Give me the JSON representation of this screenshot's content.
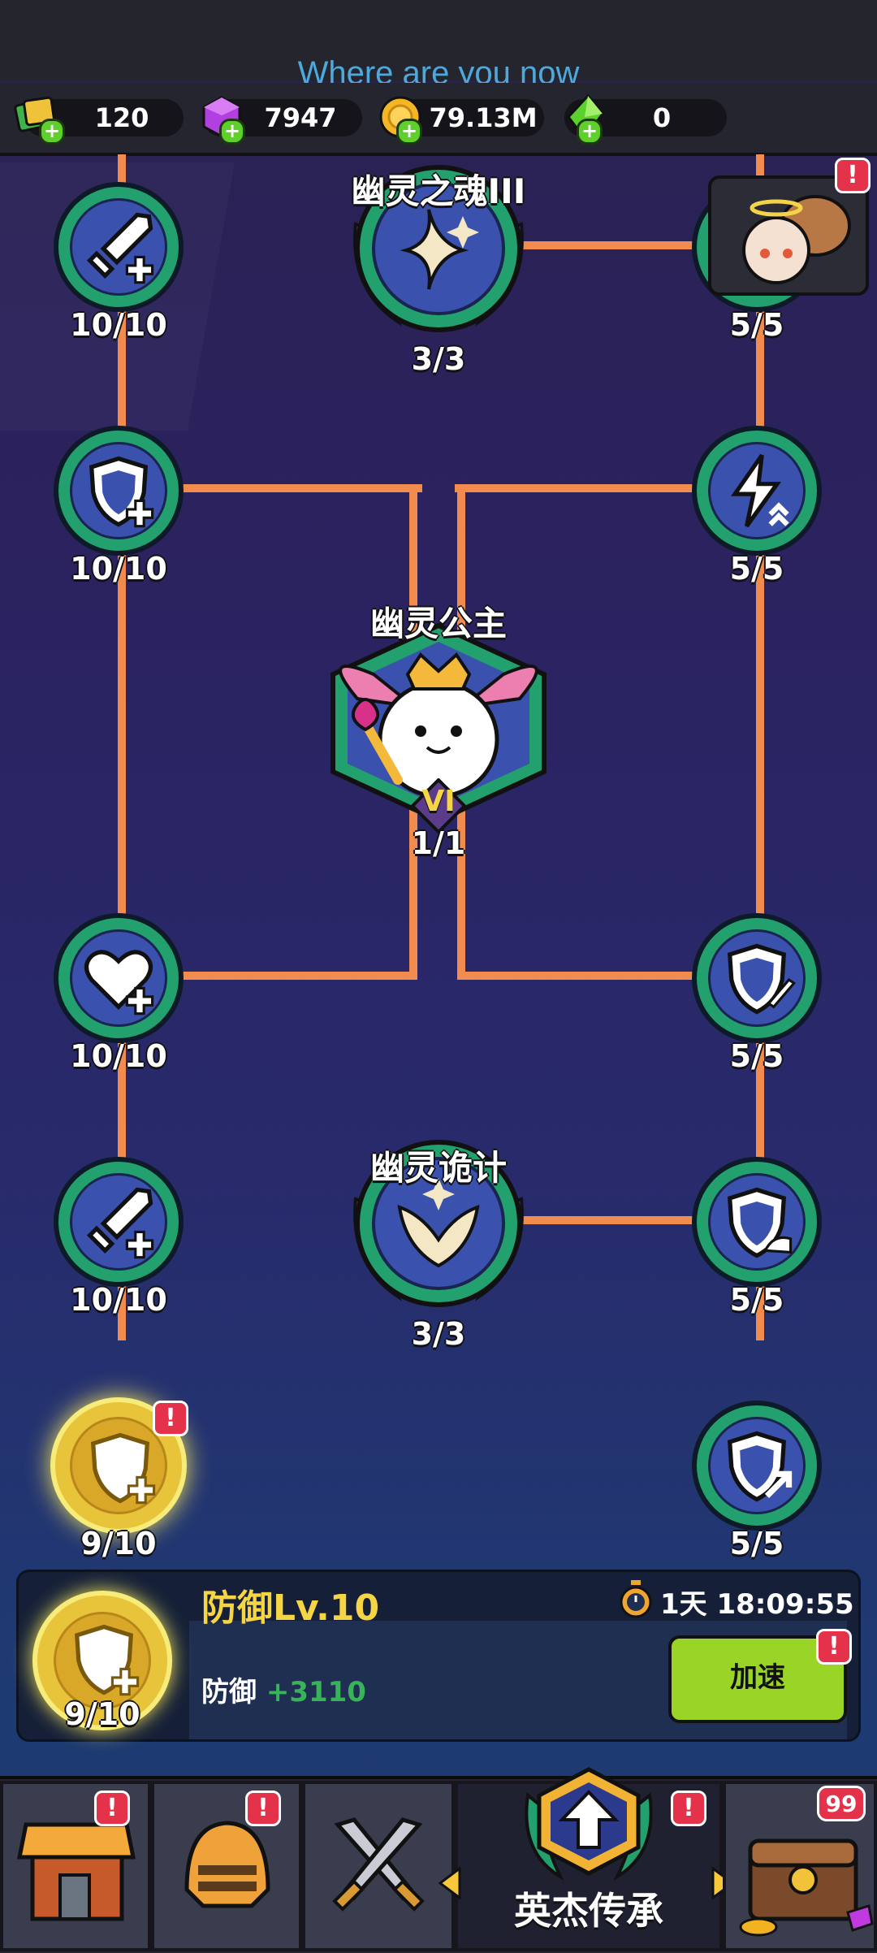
{
  "top_hint": "Where are you now",
  "resources": [
    {
      "icon": "ticket-icon",
      "value": "120"
    },
    {
      "icon": "purple-gem-icon",
      "value": "7947"
    },
    {
      "icon": "gold-coin-icon",
      "value": "79.13M"
    },
    {
      "icon": "green-crystal-icon",
      "value": "0"
    }
  ],
  "tree": {
    "top_title": "幽灵之魂III",
    "top_count": "3/3",
    "center_title": "幽灵公主",
    "center_rank": "VI",
    "center_count": "1/1",
    "lower_title": "幽灵诡计",
    "lower_count": "3/3",
    "left_nodes": [
      {
        "icon": "sword-plus-icon",
        "count": "10/10"
      },
      {
        "icon": "shield-plus-icon",
        "count": "10/10"
      },
      {
        "icon": "heart-plus-icon",
        "count": "10/10"
      },
      {
        "icon": "sword-plus-icon",
        "count": "10/10"
      },
      {
        "icon": "shield-plus-icon",
        "count": "9/10"
      }
    ],
    "right_nodes": [
      {
        "icon": "portrait-icon",
        "count": "5/5"
      },
      {
        "icon": "lightning-up-icon",
        "count": "5/5"
      },
      {
        "icon": "shield-sword-icon",
        "count": "5/5"
      },
      {
        "icon": "shield-hand-icon",
        "count": "5/5"
      },
      {
        "icon": "shield-arrow-icon",
        "count": "5/5"
      }
    ]
  },
  "detail": {
    "title": "防御Lv.10",
    "timer": "1天 18:09:55",
    "stat_label": "防御",
    "stat_value": "+3110",
    "progress": "9/10",
    "speed_button": "加速"
  },
  "nav": {
    "active_label": "英杰传承",
    "chest_badge": "99"
  },
  "colors": {
    "line": "#f18c4e",
    "node_ring": "#22a06e",
    "node_fill": "#3a51ad",
    "alert": "#e3324a",
    "button": "#9ad427",
    "title_gold": "#f6d545"
  }
}
